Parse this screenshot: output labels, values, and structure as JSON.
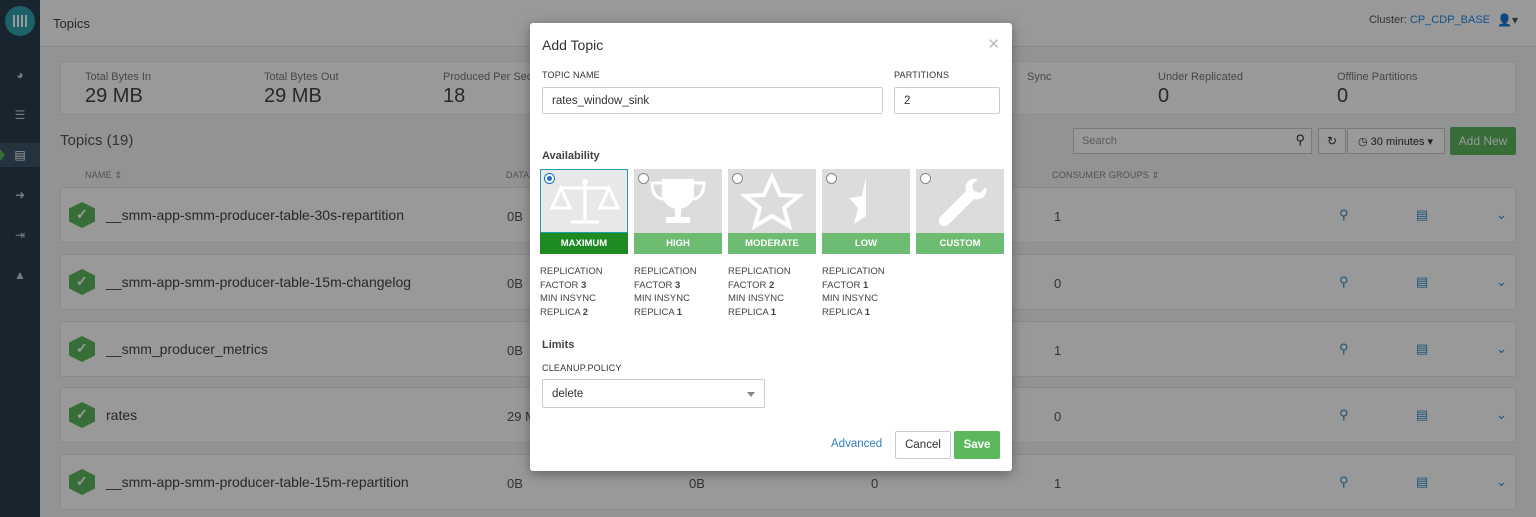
{
  "topbar": {
    "title": "Topics",
    "cluster_label": "Cluster:",
    "cluster_name": "CP_CDP_BASE"
  },
  "stats": [
    {
      "label": "Total Bytes In",
      "value": "29 MB"
    },
    {
      "label": "Total Bytes Out",
      "value": "29 MB"
    },
    {
      "label": "Produced Per Sec",
      "value": "18"
    },
    {
      "label": "Sync",
      "value": ""
    },
    {
      "label": "Under Replicated",
      "value": "0"
    },
    {
      "label": "Offline Partitions",
      "value": "0"
    }
  ],
  "topics": {
    "header": "Topics (19)",
    "search_placeholder": "Search",
    "time_range": "30 minutes",
    "add_new": "Add New",
    "columns": {
      "name": "NAME",
      "data": "DATA",
      "consumer_groups": "CONSUMER GROUPS"
    },
    "rows": [
      {
        "name": "__smm-app-smm-producer-table-30s-repartition",
        "data_in": "0B",
        "data_out": "",
        "third": "",
        "consumer_groups": "1"
      },
      {
        "name": "__smm-app-smm-producer-table-15m-changelog",
        "data_in": "0B",
        "data_out": "",
        "third": "",
        "consumer_groups": "0"
      },
      {
        "name": "__smm_producer_metrics",
        "data_in": "0B",
        "data_out": "",
        "third": "",
        "consumer_groups": "1"
      },
      {
        "name": "rates",
        "data_in": "29 M",
        "data_out": "",
        "third": "",
        "consumer_groups": "0"
      },
      {
        "name": "__smm-app-smm-producer-table-15m-repartition",
        "data_in": "0B",
        "data_out": "0B",
        "third": "0",
        "consumer_groups": "1"
      }
    ]
  },
  "modal": {
    "title": "Add Topic",
    "topic_name_label": "TOPIC NAME",
    "topic_name_value": "rates_window_sink",
    "partitions_label": "PARTITIONS",
    "partitions_value": "2",
    "availability_label": "Availability",
    "availability_options": [
      {
        "label": "MAXIMUM",
        "selected": true,
        "icon": "scales-icon",
        "rep_factor": "3",
        "min_insync": "2"
      },
      {
        "label": "HIGH",
        "selected": false,
        "icon": "trophy-icon",
        "rep_factor": "3",
        "min_insync": "1"
      },
      {
        "label": "MODERATE",
        "selected": false,
        "icon": "star-icon",
        "rep_factor": "2",
        "min_insync": "1"
      },
      {
        "label": "LOW",
        "selected": false,
        "icon": "half-star-icon",
        "rep_factor": "1",
        "min_insync": "1"
      },
      {
        "label": "CUSTOM",
        "selected": false,
        "icon": "wrench-icon"
      }
    ],
    "replication_text": "REPLICATION",
    "factor_text": "FACTOR",
    "min_insync_text": "MIN INSYNC",
    "replica_text": "REPLICA",
    "limits_label": "Limits",
    "cleanup_label": "CLEANUP.POLICY",
    "cleanup_value": "delete",
    "advanced": "Advanced",
    "cancel": "Cancel",
    "save": "Save"
  },
  "colors": {
    "accent_green": "#5cb85c",
    "selected_green": "#1d8a22",
    "link_blue": "#2f7fbf",
    "sidebar": "#2b3f4d"
  }
}
